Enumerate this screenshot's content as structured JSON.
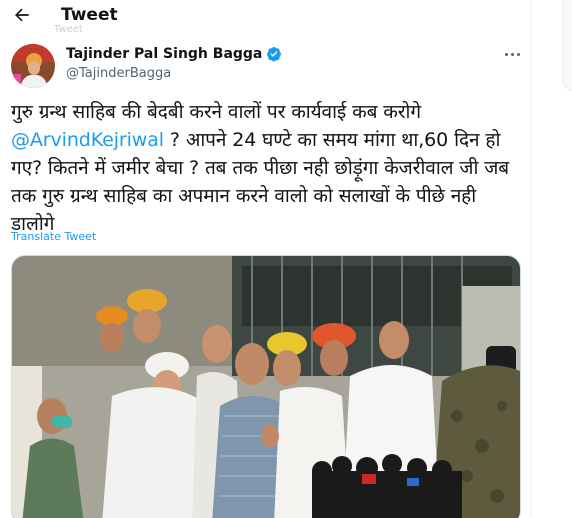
{
  "header": {
    "title": "Tweet",
    "back_icon": "arrow-left-icon",
    "faded_text": "Tweet"
  },
  "author": {
    "name": "Tajinder Pal Singh Bagga",
    "handle": "@TajinderBagga",
    "verified_color": "#1d9bf0",
    "avatar_icon": "user-avatar"
  },
  "tweet": {
    "text_part1": "गुरु ग्रन्थ साहिब की बेदबी करने वालों पर कार्यवाई कब करोगे ",
    "mention": "@ArvindKejriwal",
    "text_part2": " ? आपने 24 घण्टे का समय मांगा था,60 दिन हो गए? कितने में जमीर बेचा ? तब तक पीछा नही छोड़ूंगा केजरीवाल जी जब तक गुरु ग्रन्थ साहिब का अपमान करने वालो को सलाखों के पीछे नही डालोगे",
    "translate_label": "Translate Tweet"
  },
  "colors": {
    "accent": "#1d9bf0",
    "text": "#0f1419",
    "secondary": "#536471"
  }
}
